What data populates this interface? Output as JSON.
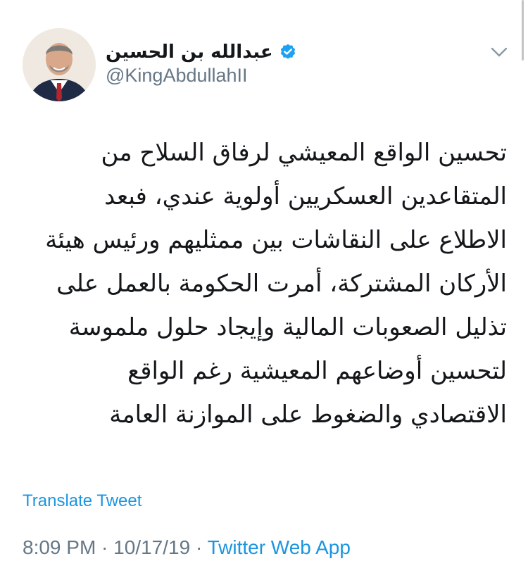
{
  "author": {
    "display_name": "عبدالله بن الحسين",
    "handle": "@KingAbdullahII",
    "verified": true,
    "avatar_icon": "profile-photo"
  },
  "tweet": {
    "lines": [
      "تحسين الواقع المعيشي لرفاق السلاح من",
      "المتقاعدين العسكريين أولوية عندي، فبعد",
      "الاطلاع على النقاشات بين ممثليهم ورئيس هيئة",
      "الأركان المشتركة، أمرت الحكومة بالعمل على",
      "تذليل الصعوبات المالية وإيجاد حلول ملموسة",
      "لتحسين أوضاعهم المعيشية رغم الواقع",
      "الاقتصادي والضغوط على الموازنة العامة"
    ],
    "translate_label": "Translate Tweet"
  },
  "meta": {
    "time": "8:09 PM",
    "sep1": " · ",
    "date": "10/17/19",
    "sep2": " · ",
    "source": "Twitter Web App"
  },
  "colors": {
    "link": "#1b95e0",
    "secondary_text": "#657786",
    "verified_badge": "#1da1f2"
  }
}
